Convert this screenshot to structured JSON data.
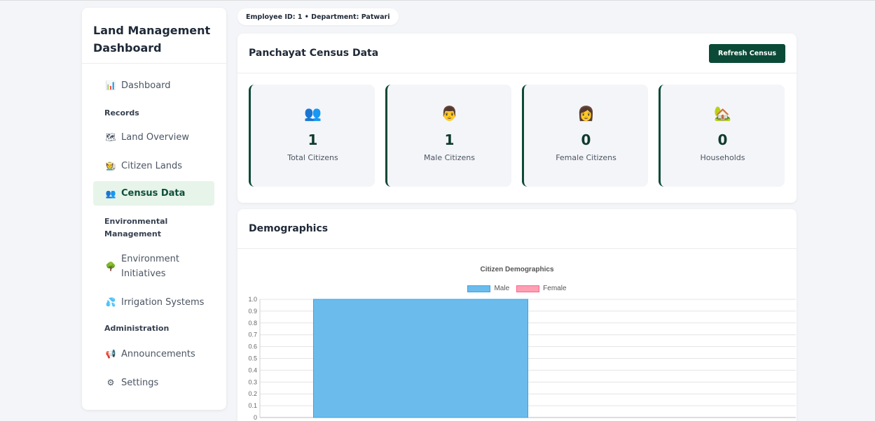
{
  "sidebar": {
    "title": "Land Management Dashboard",
    "items": [
      {
        "kind": "item",
        "label": "Dashboard",
        "icon": "📊",
        "icon_name": "bar-chart-icon"
      },
      {
        "kind": "section",
        "label": "Records"
      },
      {
        "kind": "item",
        "label": "Land Overview",
        "icon": "🗺",
        "icon_name": "map-icon"
      },
      {
        "kind": "item",
        "label": "Citizen Lands",
        "icon": "🧑‍🌾",
        "icon_name": "farmer-icon"
      },
      {
        "kind": "item",
        "label": "Census Data",
        "icon": "👥",
        "icon_name": "people-icon",
        "active": true
      },
      {
        "kind": "section",
        "label": "Environmental Management"
      },
      {
        "kind": "item",
        "label": "Environment Initiatives",
        "icon": "🌳",
        "icon_name": "tree-icon"
      },
      {
        "kind": "item",
        "label": "Irrigation Systems",
        "icon": "💦",
        "icon_name": "water-drops-icon"
      },
      {
        "kind": "section",
        "label": "Administration"
      },
      {
        "kind": "item",
        "label": "Announcements",
        "icon": "📢",
        "icon_name": "megaphone-icon"
      },
      {
        "kind": "item",
        "label": "Settings",
        "icon": "⚙",
        "icon_name": "gear-icon"
      }
    ]
  },
  "header": {
    "employee_badge": "Employee ID: 1 • Department: Patwari"
  },
  "census": {
    "title": "Panchayat Census Data",
    "refresh_label": "Refresh Census",
    "stats": [
      {
        "icon": "👥",
        "icon_name": "people-icon",
        "value": "1",
        "label": "Total Citizens"
      },
      {
        "icon": "👨",
        "icon_name": "man-icon",
        "value": "1",
        "label": "Male Citizens"
      },
      {
        "icon": "👩",
        "icon_name": "woman-icon",
        "value": "0",
        "label": "Female Citizens"
      },
      {
        "icon": "🏡",
        "icon_name": "house-icon",
        "value": "0",
        "label": "Households"
      }
    ]
  },
  "demographics": {
    "title": "Demographics"
  },
  "colors": {
    "accent": "#0b4a36",
    "male_fill": "#6bbcec",
    "male_border": "#36a2eb",
    "female_fill": "#ff9fb4",
    "female_border": "#ff6384"
  },
  "chart_data": {
    "type": "bar",
    "title": "Citizen Demographics",
    "categories": [
      ""
    ],
    "series": [
      {
        "name": "Male",
        "values": [
          1
        ]
      },
      {
        "name": "Female",
        "values": [
          0
        ]
      }
    ],
    "yticks": [
      "0",
      "0.1",
      "0.2",
      "0.3",
      "0.4",
      "0.5",
      "0.6",
      "0.7",
      "0.8",
      "0.9",
      "1.0"
    ],
    "ylim": [
      0,
      1
    ],
    "legend": "top",
    "grid": true
  }
}
